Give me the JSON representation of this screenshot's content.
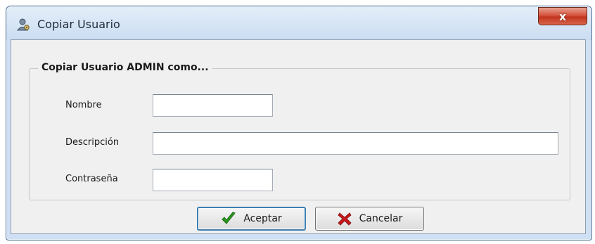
{
  "window": {
    "title": "Copiar Usuario",
    "close_glyph": "x",
    "app_icon": "user-gear-icon"
  },
  "group": {
    "legend": "Copiar Usuario ADMIN como..."
  },
  "form": {
    "nombre_label": "Nombre",
    "nombre_value": "",
    "descripcion_label": "Descripción",
    "descripcion_value": "",
    "contrasena_label": "Contraseña",
    "contrasena_value": ""
  },
  "buttons": {
    "accept_label": "Aceptar",
    "accept_icon": "checkmark-icon",
    "cancel_label": "Cancelar",
    "cancel_icon": "cross-icon"
  },
  "colors": {
    "accept_icon": "#2a9a1e",
    "cancel_icon": "#c8171a",
    "close_button": "#c7412a"
  }
}
